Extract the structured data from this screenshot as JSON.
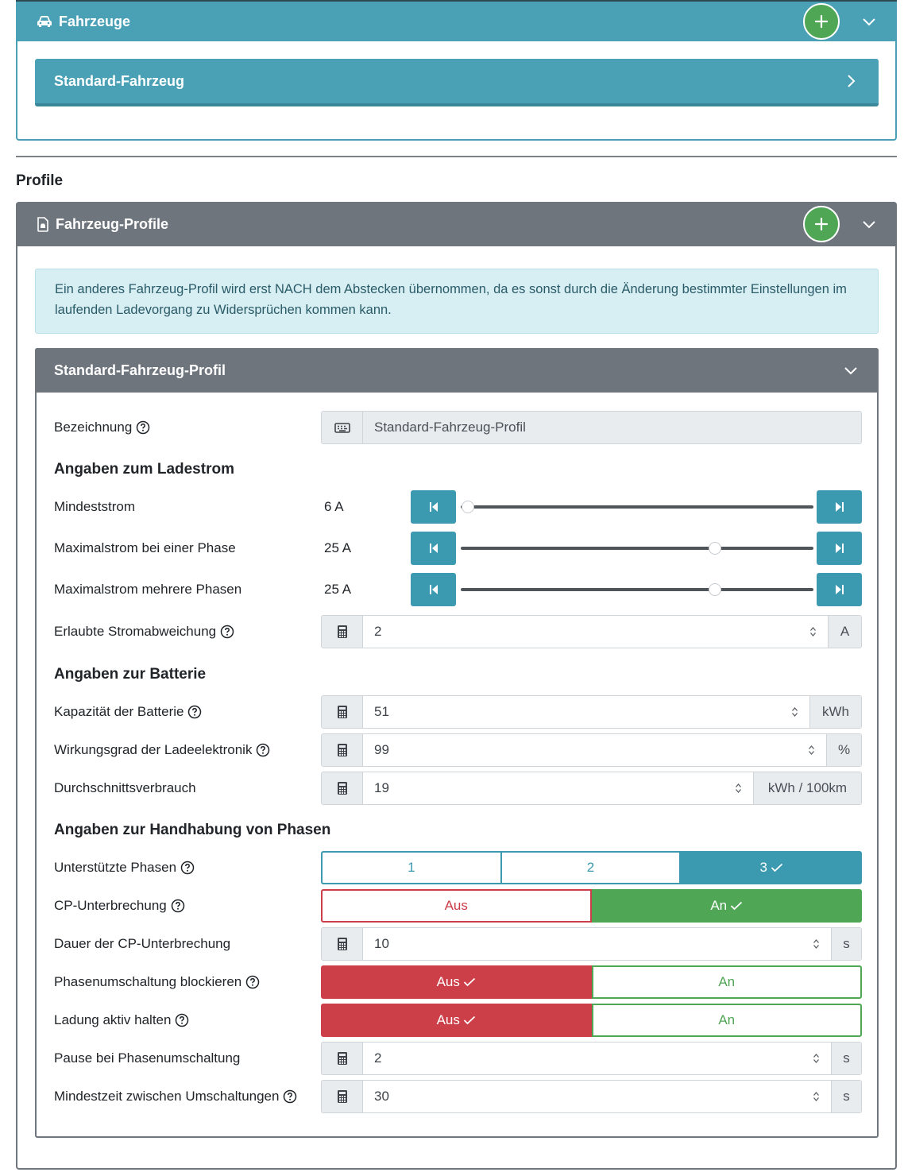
{
  "vehicles": {
    "header_title": "Fahrzeuge",
    "items": [
      {
        "label": "Standard-Fahrzeug"
      }
    ]
  },
  "profiles_section": {
    "title": "Profile"
  },
  "profiles_card": {
    "header_title": "Fahrzeug-Profile",
    "info_text": "Ein anderes Fahrzeug-Profil wird erst NACH dem Abstecken übernommen, da es sonst durch die Änderung bestimmter Einstellungen im laufenden Ladevorgang zu Widersprüchen kommen kann."
  },
  "profile": {
    "title": "Standard-Fahrzeug-Profil",
    "name": {
      "label": "Bezeichnung",
      "value": "Standard-Fahrzeug-Profil"
    },
    "current": {
      "heading": "Angaben zum Ladestrom",
      "min": {
        "label": "Mindeststrom",
        "value_text": "6 A",
        "fraction": 0.02
      },
      "max_one": {
        "label": "Maximalstrom bei einer Phase",
        "value_text": "25 A",
        "fraction": 0.72
      },
      "max_multi": {
        "label": "Maximalstrom mehrere Phasen",
        "value_text": "25 A",
        "fraction": 0.72
      },
      "deviation": {
        "label": "Erlaubte Stromabweichung",
        "value": "2",
        "unit": "A"
      }
    },
    "battery": {
      "heading": "Angaben zur Batterie",
      "capacity": {
        "label": "Kapazität der Batterie",
        "value": "51",
        "unit": "kWh"
      },
      "efficiency": {
        "label": "Wirkungsgrad der Ladeelektronik",
        "value": "99",
        "unit": "%"
      },
      "consumption": {
        "label": "Durchschnittsverbrauch",
        "value": "19",
        "unit": "kWh / 100km"
      }
    },
    "phases": {
      "heading": "Angaben zur Handhabung von Phasen",
      "supported": {
        "label": "Unterstützte Phasen",
        "options": [
          "1",
          "2",
          "3"
        ],
        "selected": "3"
      },
      "cp_interrupt": {
        "label": "CP-Unterbrechung",
        "off": "Aus",
        "on": "An",
        "selected": "An"
      },
      "cp_duration": {
        "label": "Dauer der CP-Unterbrechung",
        "value": "10",
        "unit": "s"
      },
      "block_switch": {
        "label": "Phasenumschaltung blockieren",
        "off": "Aus",
        "on": "An",
        "selected": "Aus"
      },
      "keep_active": {
        "label": "Ladung aktiv halten",
        "off": "Aus",
        "on": "An",
        "selected": "Aus"
      },
      "pause": {
        "label": "Pause bei Phasenumschaltung",
        "value": "2",
        "unit": "s"
      },
      "min_time": {
        "label": "Mindestzeit zwischen Umschaltungen",
        "value": "30",
        "unit": "s"
      }
    }
  },
  "colors": {
    "info": "#4aa1b5",
    "secondary": "#6e757c",
    "success": "#4fa655",
    "danger": "#cc3e48"
  }
}
